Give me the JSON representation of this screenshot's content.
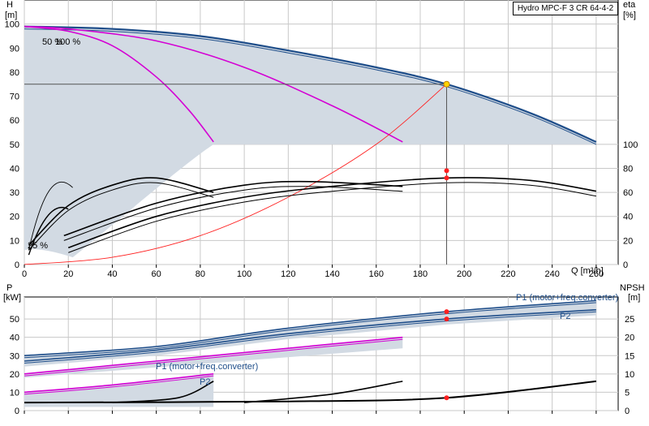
{
  "chart_data": [
    {
      "type": "line",
      "title": "Hydro MPC-F 3 CR 64-4-2",
      "xlabel": "Q [m³/h]",
      "ylabel": "H [m]",
      "ylabel_short": "H",
      "ylabel_unit": "[m]",
      "y2label_short": "eta",
      "y2label_unit": "[%]",
      "xlim": [
        0,
        270
      ],
      "ylim": [
        0,
        110
      ],
      "y2lim_shown": [
        0,
        100
      ],
      "x_ticks": [
        "0",
        "20",
        "40",
        "60",
        "80",
        "100",
        "120",
        "140",
        "160",
        "180",
        "200",
        "220",
        "240",
        "260"
      ],
      "y_ticks": [
        "0",
        "10",
        "20",
        "30",
        "40",
        "50",
        "60",
        "70",
        "80",
        "90",
        "100"
      ],
      "y2_ticks": [
        "0",
        "20",
        "40",
        "60",
        "80",
        "100"
      ],
      "annotations": [
        "50 %",
        "100 %",
        "25 %"
      ],
      "grid": true,
      "duty_point": {
        "x": 192,
        "y": 75
      },
      "series": [
        {
          "role": "head-3pumps-max",
          "color": "#1f4e8a",
          "x": [
            0,
            40,
            80,
            120,
            160,
            192,
            230,
            260
          ],
          "values": [
            99,
            98,
            95,
            89,
            82,
            75,
            63,
            51
          ]
        },
        {
          "role": "head-2pumps",
          "color": "#d400d4",
          "x": [
            0,
            20,
            60,
            100,
            140,
            172
          ],
          "values": [
            99,
            98,
            93,
            82,
            66,
            51
          ]
        },
        {
          "role": "head-1pump",
          "color": "#d400d4",
          "x": [
            0,
            20,
            40,
            60,
            75,
            86
          ],
          "values": [
            99,
            97,
            91,
            78,
            64,
            51
          ]
        },
        {
          "role": "system-curve",
          "color": "#ff2020",
          "x": [
            0,
            40,
            80,
            120,
            160,
            192
          ],
          "values": [
            0,
            3,
            12,
            28,
            50,
            75
          ]
        },
        {
          "role": "eta-3pumps",
          "color": "#000000",
          "x": [
            20,
            60,
            100,
            140,
            192,
            230,
            260
          ],
          "values": [
            14,
            40,
            56,
            65,
            72,
            70,
            61
          ]
        },
        {
          "role": "eta-2pumps",
          "color": "#000000",
          "x": [
            18,
            60,
            100,
            130,
            172
          ],
          "values": [
            24,
            51,
            66,
            69,
            65
          ]
        },
        {
          "role": "eta-1pump",
          "color": "#000000",
          "x": [
            2,
            20,
            40,
            60,
            86
          ],
          "values": [
            16,
            49,
            66,
            72,
            60
          ]
        }
      ]
    },
    {
      "type": "line",
      "xlabel": "",
      "ylabel_short": "P",
      "ylabel_unit": "[kW]",
      "y2label_short": "NPSH",
      "y2label_unit": "[m]",
      "xlim": [
        0,
        270
      ],
      "ylim": [
        0,
        62
      ],
      "y2lim": [
        0,
        31
      ],
      "y_ticks": [
        "0",
        "10",
        "20",
        "30",
        "40",
        "50"
      ],
      "y2_ticks": [
        "0",
        "5",
        "10",
        "15",
        "20",
        "25"
      ],
      "legend_labels": [
        "P1 (motor+freq.converter)",
        "P2",
        "P1 (motor+freq.converter)",
        "P2"
      ],
      "grid": true,
      "series": [
        {
          "role": "P1-3pumps",
          "color": "#1f4e8a",
          "x": [
            0,
            60,
            120,
            192,
            260
          ],
          "values": [
            30,
            35,
            45,
            54,
            60
          ]
        },
        {
          "role": "P2-3pumps",
          "color": "#1f4e8a",
          "x": [
            0,
            60,
            120,
            192,
            260
          ],
          "values": [
            27,
            33,
            42,
            50,
            55
          ]
        },
        {
          "role": "P1-2pumps",
          "color": "#d400d4",
          "x": [
            0,
            60,
            120,
            172
          ],
          "values": [
            20,
            27,
            34,
            40
          ]
        },
        {
          "role": "P1-1pump",
          "color": "#d400d4",
          "x": [
            0,
            40,
            86
          ],
          "values": [
            10,
            14,
            20
          ]
        },
        {
          "role": "NPSH-3pumps",
          "color": "#000000",
          "x": [
            0,
            120,
            192,
            260
          ],
          "values_npsh": [
            2.2,
            2.5,
            3.5,
            8
          ]
        },
        {
          "role": "NPSH-2pumps",
          "color": "#000000",
          "x": [
            100,
            140,
            172
          ],
          "values_npsh": [
            2.2,
            4.5,
            8
          ]
        },
        {
          "role": "NPSH-1pump",
          "color": "#000000",
          "x": [
            40,
            70,
            86
          ],
          "values_npsh": [
            2.2,
            3.5,
            8
          ]
        }
      ]
    }
  ]
}
